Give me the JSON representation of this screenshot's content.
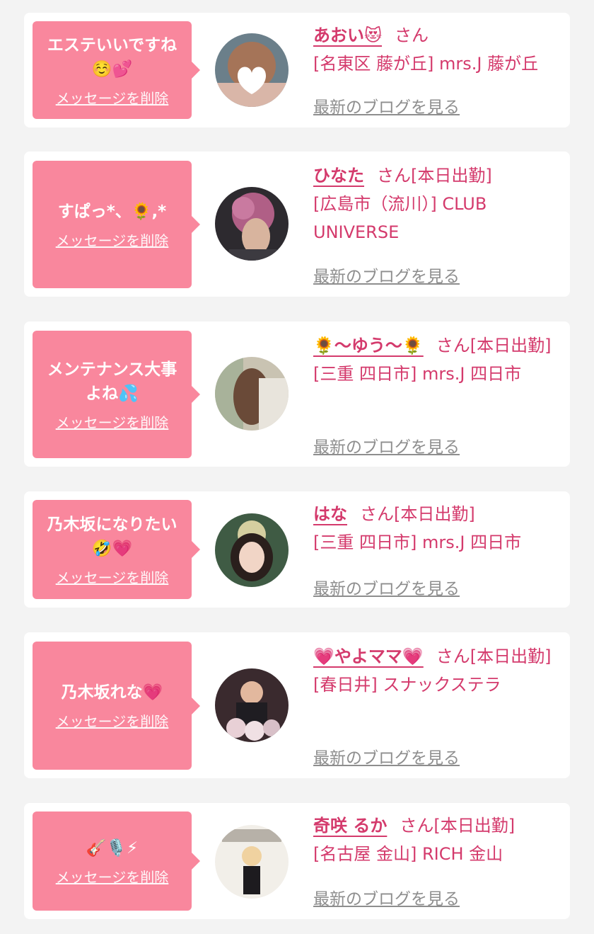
{
  "delete_label": "メッセージを削除",
  "blog_label": "最新のブログを見る",
  "san_label": "さん",
  "colors": {
    "bubble": "#f9879d",
    "name": "#d43a6c",
    "blog": "#8e8e8e",
    "bg": "#f3f3f3"
  },
  "messages": [
    {
      "bubble_text": "エステいいですね\n☺️💕",
      "name": "あおい😻",
      "after_name": "",
      "line2": "[名東区 藤が丘] mrs.J 藤が丘"
    },
    {
      "bubble_text": "すぱっ*、🌻,*",
      "name": "ひなた",
      "after_name": "[本日出勤]",
      "line2": "[広島市（流川）] CLUB UNIVERSE"
    },
    {
      "bubble_text": "メンテナンス大事\nよね💦",
      "name": "🌻〜ゆう〜🌻",
      "after_name": "[本日出勤]",
      "line2": "[三重 四日市] mrs.J 四日市"
    },
    {
      "bubble_text": "乃木坂になりたい\n🤣💗",
      "name": "はな",
      "after_name": "[本日出勤]",
      "line2": "[三重 四日市] mrs.J 四日市"
    },
    {
      "bubble_text": "乃木坂れな💗",
      "name": "💗やよママ💗",
      "after_name": "[本日出勤]",
      "line2": "[春日井] スナックステラ"
    },
    {
      "bubble_text": "🎸🎙️⚡",
      "name": "奇咲 るか",
      "after_name": "[本日出勤]",
      "line2": "[名古屋 金山] RICH 金山"
    }
  ]
}
